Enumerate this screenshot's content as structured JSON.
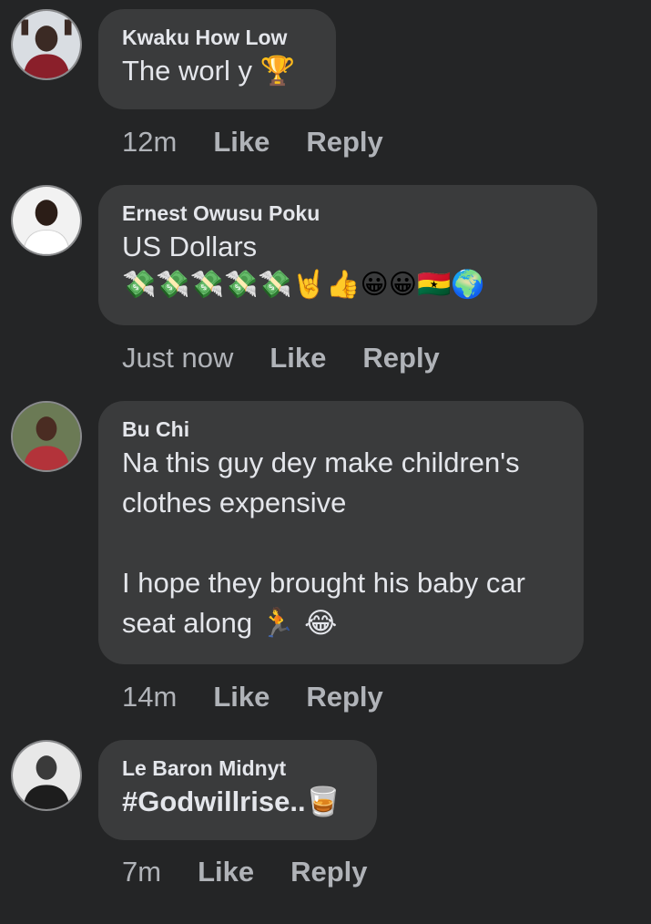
{
  "comments": [
    {
      "author": "Kwaku How Low",
      "text": "The worl y",
      "emoji": "🏆",
      "time": "12m",
      "like": "Like",
      "reply": "Reply"
    },
    {
      "author": "Ernest Owusu Poku",
      "text": "US Dollars",
      "emoji": "💸💸💸💸💸🤘👍😀😀🇬🇭🌍",
      "time": "Just now",
      "like": "Like",
      "reply": "Reply"
    },
    {
      "author": "Bu Chi",
      "text": "Na this guy dey make children's clothes expensive\n\nI hope they brought his baby car seat along",
      "emoji": "🏃 😂",
      "time": "14m",
      "like": "Like",
      "reply": "Reply"
    },
    {
      "author": "Le Baron Midnyt",
      "text": "#Godwillrise..",
      "emoji": "🥃",
      "time": "7m",
      "like": "Like",
      "reply": "Reply"
    }
  ]
}
